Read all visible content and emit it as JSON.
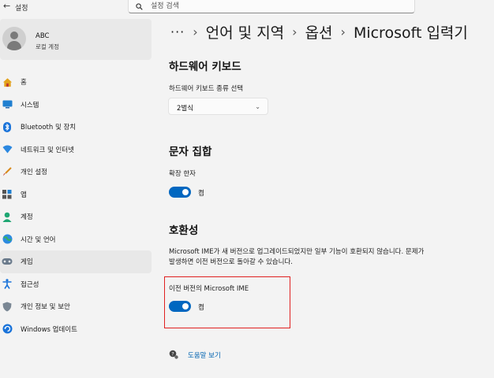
{
  "app": {
    "title": "설정",
    "back_icon": "back-arrow-icon"
  },
  "search": {
    "placeholder": "설정 검색",
    "icon": "search-icon"
  },
  "profile": {
    "name": "ABC",
    "account_type": "로컬 계정"
  },
  "sidebar": {
    "active_index": 8,
    "items": [
      {
        "label": "홈",
        "icon": "home-icon"
      },
      {
        "label": "시스템",
        "icon": "system-icon"
      },
      {
        "label": "Bluetooth 및 장치",
        "icon": "bluetooth-icon"
      },
      {
        "label": "네트워크 및 인터넷",
        "icon": "network-icon"
      },
      {
        "label": "개인 설정",
        "icon": "personalization-brush-icon"
      },
      {
        "label": "앱",
        "icon": "apps-icon"
      },
      {
        "label": "계정",
        "icon": "accounts-icon"
      },
      {
        "label": "시간 및 언어",
        "icon": "time-language-icon"
      },
      {
        "label": "게임",
        "icon": "gaming-icon"
      },
      {
        "label": "접근성",
        "icon": "accessibility-icon"
      },
      {
        "label": "개인 정보 및 보안",
        "icon": "privacy-shield-icon"
      },
      {
        "label": "Windows 업데이트",
        "icon": "windows-update-icon"
      }
    ]
  },
  "breadcrumb": {
    "more": "···",
    "items": [
      "언어 및 지역",
      "옵션",
      "Microsoft 입력기"
    ]
  },
  "hardware_keyboard": {
    "title": "하드웨어 키보드",
    "type_label": "하드웨어 키보드 종류 선택",
    "selected": "2벌식"
  },
  "charset": {
    "title": "문자 집합",
    "extended_hanja_label": "확장 한자",
    "extended_hanja_state": "켬"
  },
  "compatibility": {
    "title": "호환성",
    "description": "Microsoft IME가 새 버전으로 업그레이드되었지만 일부 기능이 호환되지 않습니다. 문제가 발생하면 이전 버전으로 돌아갈 수 있습니다.",
    "previous_version_label": "이전 버전의 Microsoft IME",
    "previous_version_state": "켬"
  },
  "help": {
    "link_text": "도움말 보기"
  },
  "colors": {
    "accent": "#0067c0",
    "highlight_border": "#e02020",
    "link": "#0063b1"
  }
}
